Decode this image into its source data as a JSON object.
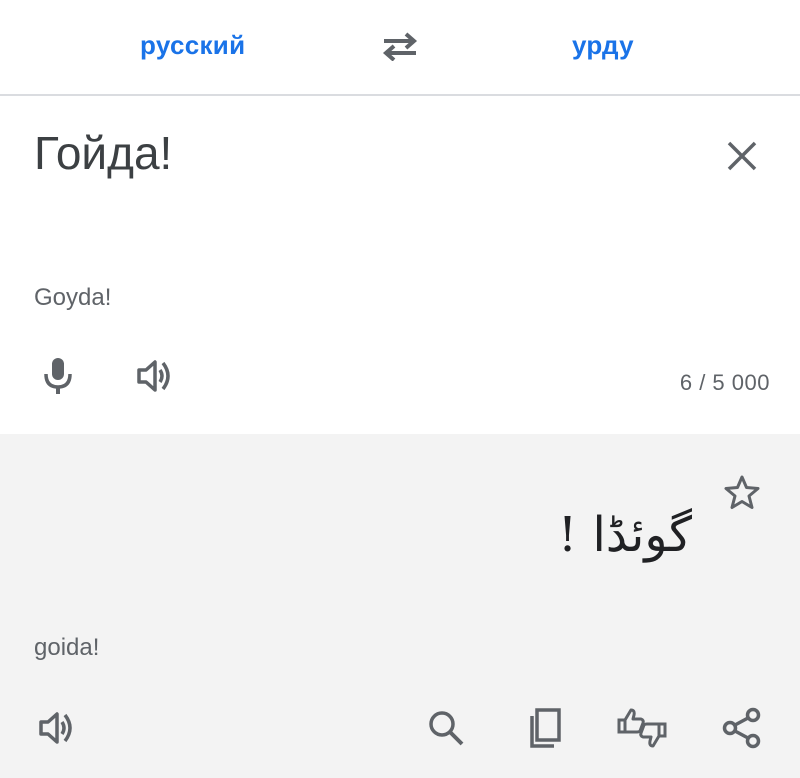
{
  "header": {
    "source_lang": "русский",
    "target_lang": "урду",
    "swap_icon": "swap-horiz-icon"
  },
  "input": {
    "text": "Гойда!",
    "transliteration": "Goyda!",
    "char_count": "6 / 5 000",
    "icons": [
      "close-icon",
      "microphone-icon",
      "volume-icon"
    ]
  },
  "output": {
    "text": "گوئڈا !",
    "transliteration": "goida!",
    "icons": [
      "star-icon",
      "volume-icon",
      "search-icon",
      "copy-icon",
      "feedback-thumbs-icon",
      "share-icon"
    ]
  },
  "colors": {
    "accent": "#1a73e8",
    "icon": "#5f6368",
    "output_bg": "#f3f3f3",
    "divider": "#dadce0"
  }
}
